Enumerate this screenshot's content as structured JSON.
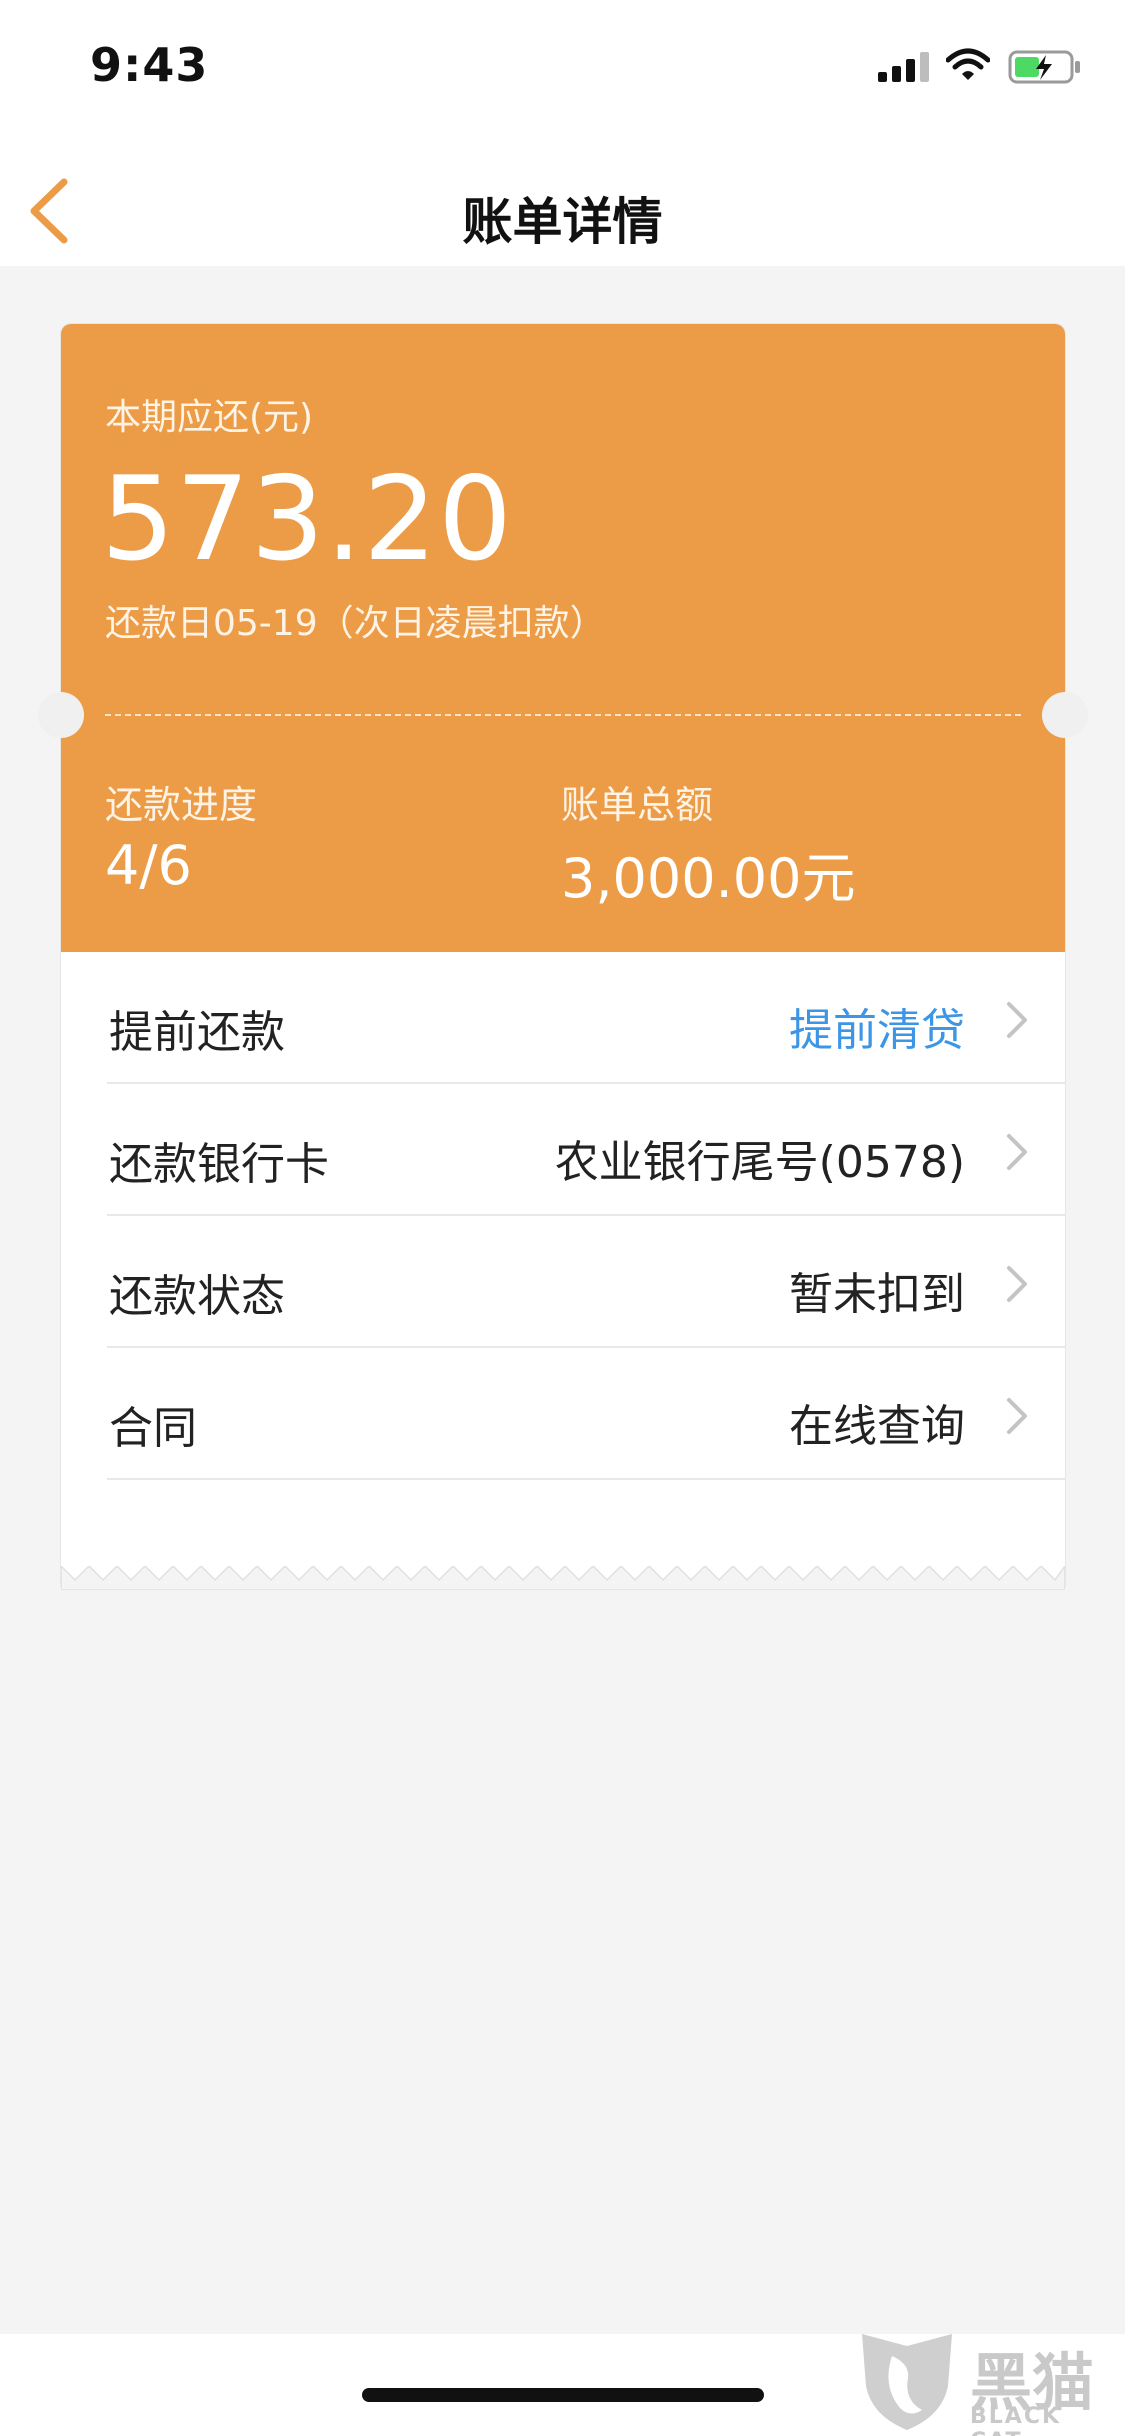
{
  "status_bar": {
    "time": "9:43",
    "icons": [
      "cellular-signal-icon",
      "wifi-icon",
      "battery-charging-icon"
    ]
  },
  "nav": {
    "title": "账单详情",
    "back_icon": "chevron-left-icon",
    "accent_color": "#ec9c47"
  },
  "summary": {
    "amount_label": "本期应还(元)",
    "amount": "573.20",
    "due_date": "还款日05-19（次日凌晨扣款）",
    "progress_label": "还款进度",
    "progress_value": "4/6",
    "total_label": "账单总额",
    "total_value": "3,000.00元",
    "card_color": "#ec9c47"
  },
  "rows": [
    {
      "label": "提前还款",
      "value": "提前清贷",
      "value_color": "#3d95e6"
    },
    {
      "label": "还款银行卡",
      "value": "农业银行尾号(0578)"
    },
    {
      "label": "还款状态",
      "value": "暂未扣到"
    },
    {
      "label": "合同",
      "value": "在线查询"
    }
  ],
  "watermark": {
    "text": "黑猫",
    "subtext": "BLACK CAT"
  }
}
